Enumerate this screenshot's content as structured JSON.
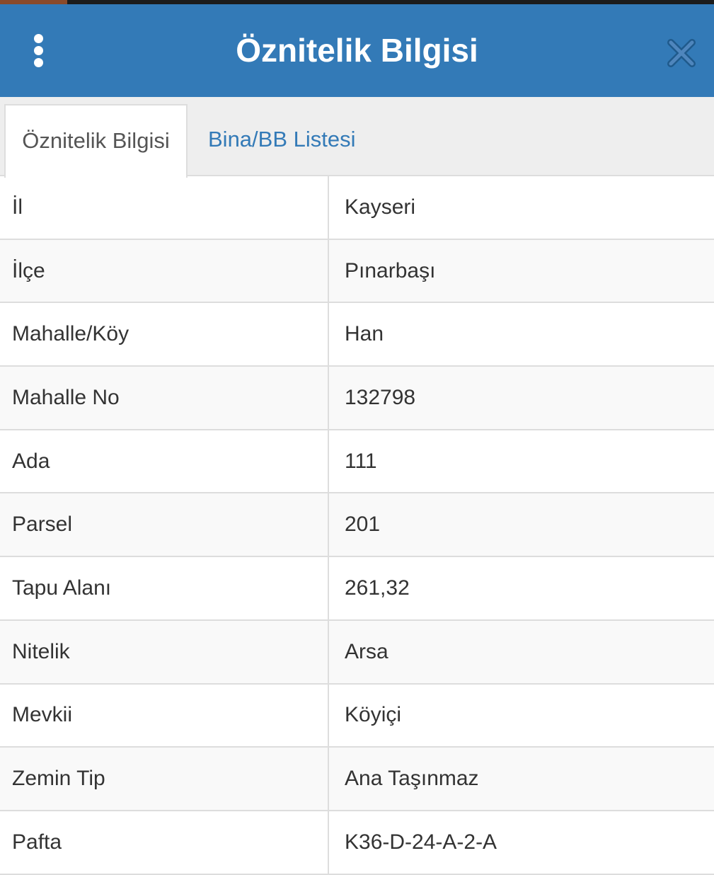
{
  "header": {
    "title": "Öznitelik Bilgisi",
    "menu_icon": "vertical-dots-icon",
    "close_icon": "close-icon"
  },
  "tabs": [
    {
      "label": "Öznitelik Bilgisi",
      "active": true
    },
    {
      "label": "Bina/BB Listesi",
      "active": false
    }
  ],
  "rows": [
    {
      "label": "İl",
      "value": "Kayseri"
    },
    {
      "label": "İlçe",
      "value": "Pınarbaşı"
    },
    {
      "label": "Mahalle/Köy",
      "value": "Han"
    },
    {
      "label": "Mahalle No",
      "value": "132798"
    },
    {
      "label": "Ada",
      "value": "111"
    },
    {
      "label": "Parsel",
      "value": "201"
    },
    {
      "label": "Tapu Alanı",
      "value": "261,32"
    },
    {
      "label": "Nitelik",
      "value": "Arsa"
    },
    {
      "label": "Mevkii",
      "value": "Köyiçi"
    },
    {
      "label": "Zemin Tip",
      "value": "Ana Taşınmaz"
    },
    {
      "label": "Pafta",
      "value": "K36-D-24-A-2-A"
    }
  ],
  "colors": {
    "header_bg": "#337ab7",
    "tab_link": "#337ab7",
    "text": "#333333",
    "border": "#dddddd"
  }
}
